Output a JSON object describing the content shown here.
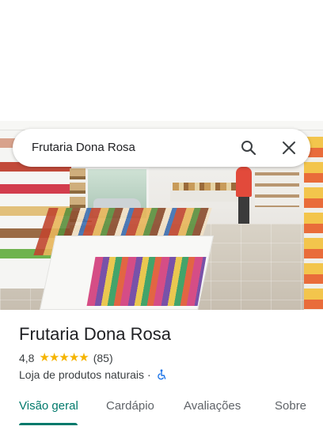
{
  "search": {
    "query": "Frutaria Dona Rosa"
  },
  "place": {
    "name": "Frutaria Dona Rosa",
    "rating": "4,8",
    "stars": [
      "★",
      "★",
      "★",
      "★",
      "★"
    ],
    "review_count": "(85)",
    "category": "Loja de produtos naturais",
    "separator": "·"
  },
  "tabs": [
    {
      "label": "Visão geral",
      "active": true
    },
    {
      "label": "Cardápio",
      "active": false
    },
    {
      "label": "Avaliações",
      "active": false
    },
    {
      "label": "Sobre",
      "active": false
    }
  ],
  "icons": {
    "search": "search-icon",
    "close": "close-icon",
    "accessibility": "wheelchair-icon"
  },
  "colors": {
    "accent": "#00796b",
    "star": "#f5b400",
    "accessibility": "#1a73e8"
  }
}
